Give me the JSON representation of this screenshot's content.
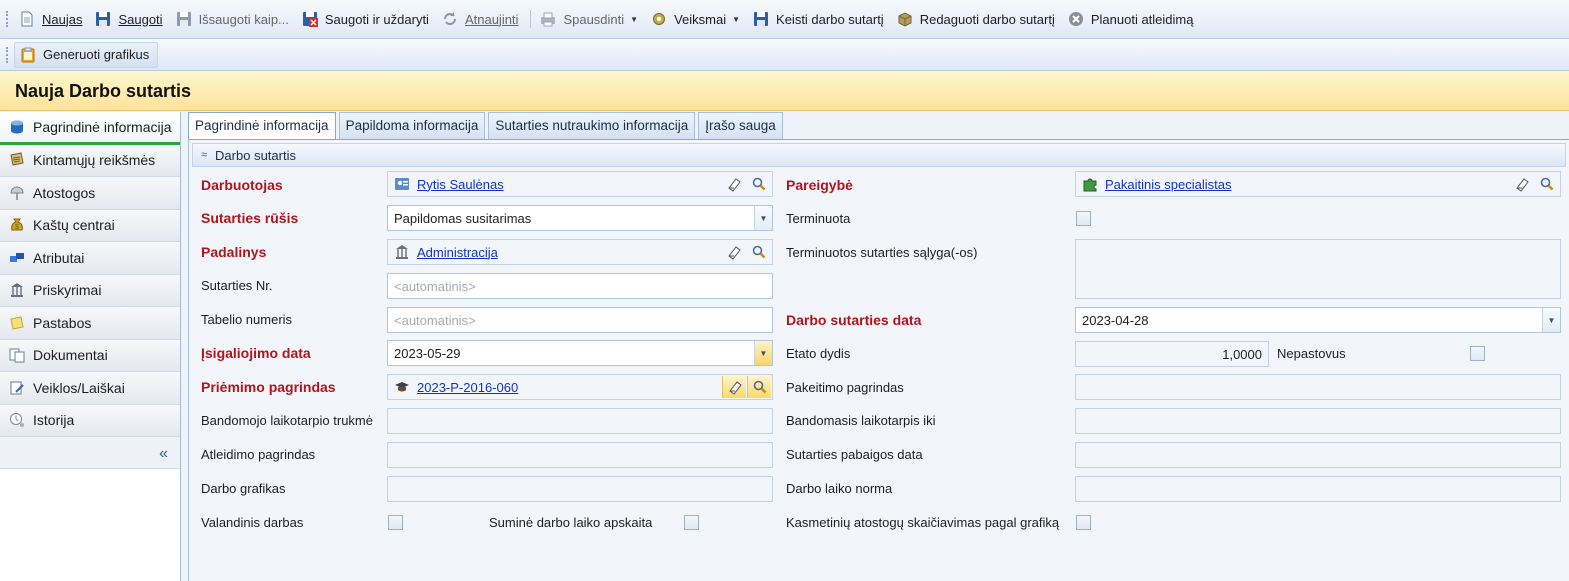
{
  "toolbar": {
    "new": "Naujas",
    "save": "Saugoti",
    "save_as": "Išsaugoti kaip...",
    "save_close": "Saugoti ir uždaryti",
    "refresh": "Atnaujinti",
    "print": "Spausdinti",
    "actions": "Veiksmai",
    "change_contract": "Keisti darbo sutartį",
    "edit_contract": "Redaguoti darbo sutartį",
    "plan_dismissal": "Planuoti atleidimą",
    "generate_schedules": "Generuoti grafikus"
  },
  "page_title": "Nauja Darbo sutartis",
  "nav": {
    "items": [
      {
        "label": "Pagrindinė informacija",
        "icon": "database-icon"
      },
      {
        "label": "Kintamųjų reikšmės",
        "icon": "notes-icon"
      },
      {
        "label": "Atostogos",
        "icon": "beach-icon"
      },
      {
        "label": "Kaštų centrai",
        "icon": "money-bag-icon"
      },
      {
        "label": "Atributai",
        "icon": "attributes-icon"
      },
      {
        "label": "Priskyrimai",
        "icon": "building-icon"
      },
      {
        "label": "Pastabos",
        "icon": "note-icon"
      },
      {
        "label": "Dokumentai",
        "icon": "documents-icon"
      },
      {
        "label": "Veiklos/Laiškai",
        "icon": "activities-icon"
      },
      {
        "label": "Istorija",
        "icon": "history-icon"
      }
    ],
    "collapse": "«"
  },
  "tabs": [
    "Pagrindinė informacija",
    "Papildoma informacija",
    "Sutarties nutraukimo informacija",
    "Įrašo sauga"
  ],
  "group": "Darbo sutartis",
  "form": {
    "employee": {
      "label": "Darbuotojas",
      "value": "Rytis Saulėnas"
    },
    "position": {
      "label": "Pareigybė",
      "value": "Pakaitinis specialistas"
    },
    "contract_type": {
      "label": "Sutarties rūšis",
      "value": "Papildomas susitarimas"
    },
    "fixed_term": {
      "label": "Terminuota"
    },
    "fixed_term_conditions": {
      "label": "Terminuotos sutarties sąlyga(-os)"
    },
    "department": {
      "label": "Padalinys",
      "value": "Administracija"
    },
    "contract_no": {
      "label": "Sutarties Nr.",
      "placeholder": "<automatinis>"
    },
    "tab_no": {
      "label": "Tabelio numeris",
      "placeholder": "<automatinis>"
    },
    "contract_date": {
      "label": "Darbo sutarties data",
      "value": "2023-04-28"
    },
    "effective_date": {
      "label": "Įsigaliojimo data",
      "value": "2023-05-29"
    },
    "fte": {
      "label": "Etato dydis",
      "value": "1,0000"
    },
    "non_permanent": {
      "label": "Nepastovus"
    },
    "hiring_basis": {
      "label": "Priėmimo pagrindas",
      "value": "2023-P-2016-060"
    },
    "change_basis": {
      "label": "Pakeitimo pagrindas"
    },
    "probation_length": {
      "label": "Bandomojo laikotarpio trukmė"
    },
    "probation_until": {
      "label": "Bandomasis laikotarpis iki"
    },
    "dismissal_basis": {
      "label": "Atleidimo pagrindas"
    },
    "contract_end": {
      "label": "Sutarties pabaigos data"
    },
    "schedule": {
      "label": "Darbo grafikas"
    },
    "work_norm": {
      "label": "Darbo laiko norma"
    },
    "hourly": {
      "label": "Valandinis darbas"
    },
    "summary_accounting": {
      "label": "Suminė darbo laiko apskaita"
    },
    "annual_leave_calc": {
      "label": "Kasmetinių atostogų skaičiavimas pagal grafiką"
    }
  }
}
